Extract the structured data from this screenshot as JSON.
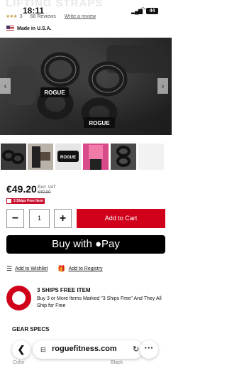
{
  "header": {
    "title_fragment": "LIFTING STRAPS"
  },
  "status_bar": {
    "time": "18:11",
    "battery": "44"
  },
  "rating": {
    "stars": "★★★",
    "count": "3",
    "reviews": "68 Reviews",
    "write_review": "Write a review"
  },
  "origin": {
    "label": "Made in U.S.A."
  },
  "gallery": {
    "brand": "ROGUE",
    "thumb_count": 6
  },
  "pricing": {
    "price": "€49.20",
    "vat_label": "Excl. VAT",
    "original_price": "€40.00",
    "badge": "3 Ships Free Item"
  },
  "quantity": {
    "value": "1",
    "minus": "−",
    "plus": "+"
  },
  "actions": {
    "add_to_cart": "Add to Cart",
    "buy_with": "Buy with",
    "pay_label": "Pay"
  },
  "links": {
    "wishlist": "Add to Wishlist",
    "registry": "Add to Registry"
  },
  "promo": {
    "title": "3 SHIPS FREE ITEM",
    "description": "Buy 3 or More Items Marked \"3 Ships Free\" And They All Ship for Free"
  },
  "specs": {
    "heading": "GEAR SPECS",
    "left_fragment": "Color",
    "right_fragment": "Black"
  },
  "browser": {
    "host": "roguefitness.com",
    "back": "❮",
    "reload": "↻",
    "more": "···"
  },
  "colors": {
    "accent_red": "#d0001b",
    "badge_red": "#c8102e",
    "star_gold": "#c8a24a"
  }
}
